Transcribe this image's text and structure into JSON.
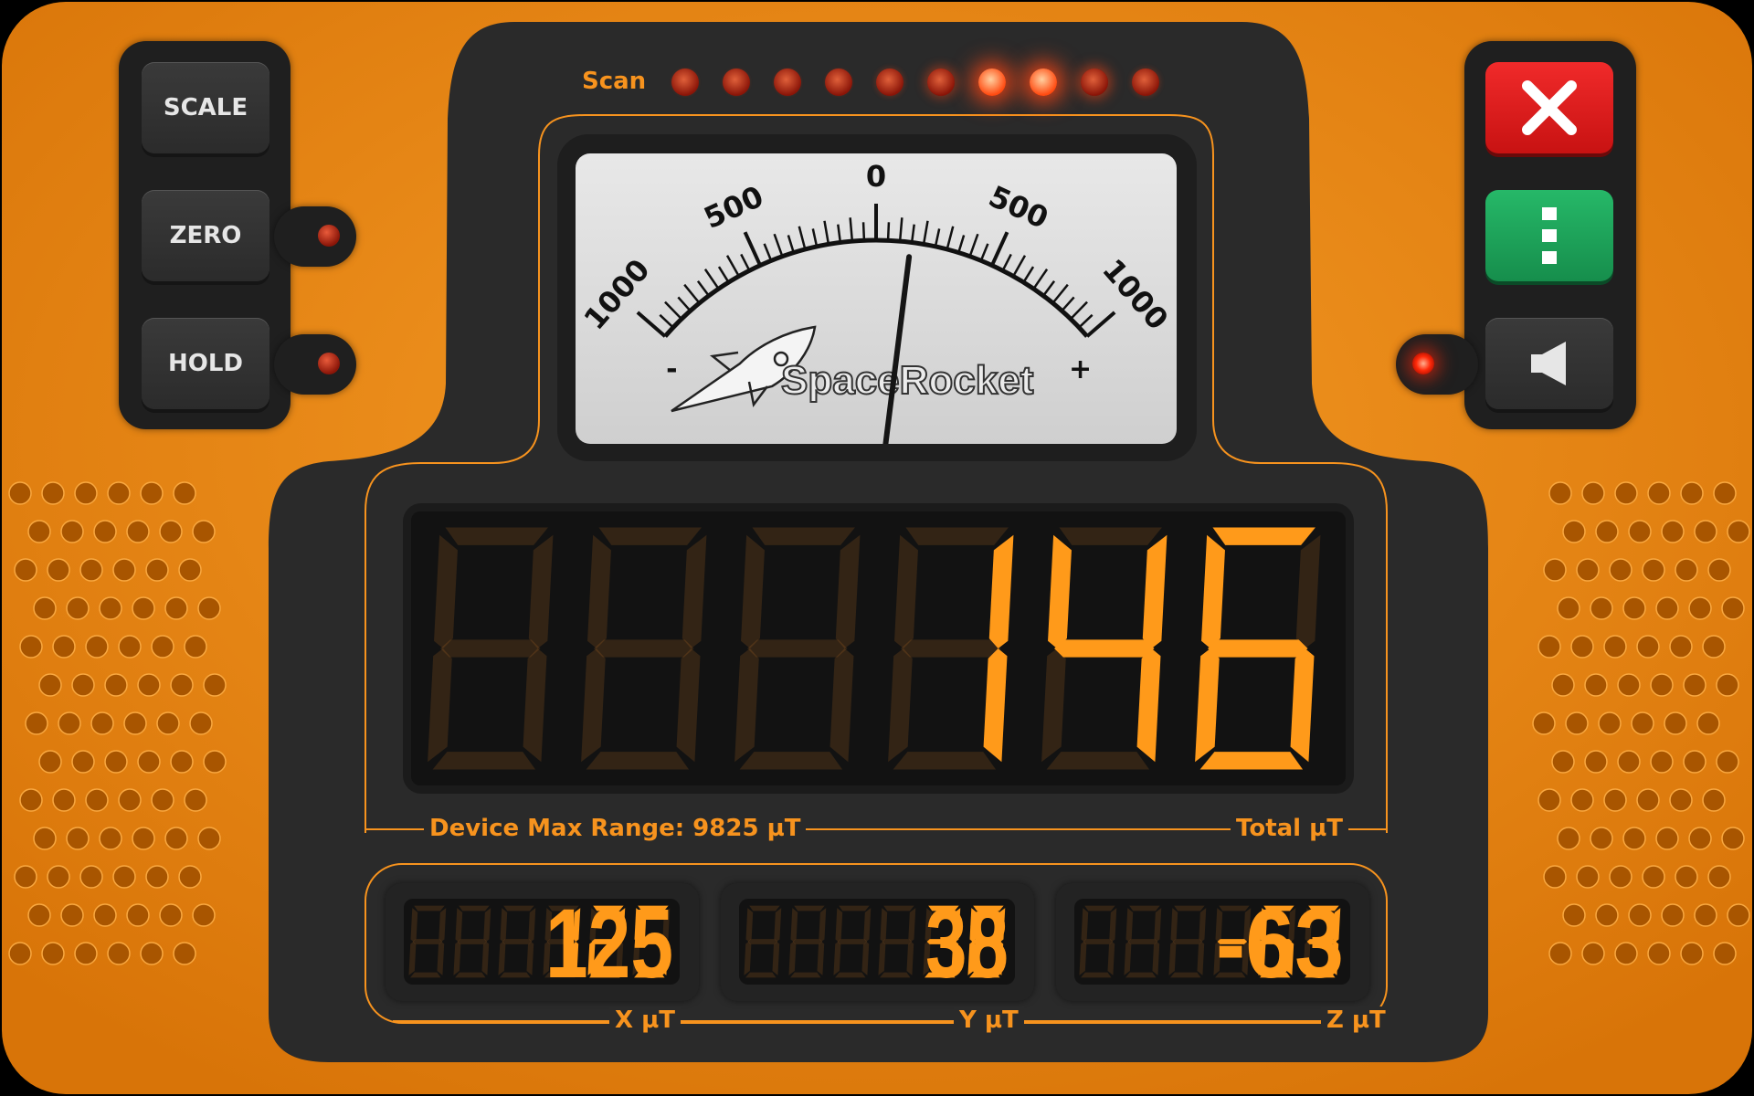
{
  "colors": {
    "body": "#f08a12",
    "panel": "#2a2a2a",
    "accent": "#f7931e",
    "lcd_lit": "#ff9a1a",
    "close": "#e01b1b",
    "menu": "#1fa35a"
  },
  "left_buttons": [
    {
      "label": "SCALE",
      "led": false
    },
    {
      "label": "ZERO",
      "led": true,
      "led_on": false
    },
    {
      "label": "HOLD",
      "led": true,
      "led_on": false
    }
  ],
  "right_buttons": [
    {
      "icon": "close-icon"
    },
    {
      "icon": "menu-dots-icon"
    },
    {
      "icon": "speaker-icon",
      "led_on": true
    }
  ],
  "scan": {
    "label": "Scan",
    "leds": [
      0.1,
      0.1,
      0.1,
      0.1,
      0.2,
      0.4,
      0.9,
      0.9,
      0.5,
      0.2
    ]
  },
  "meter": {
    "brand": "SpaceRocket",
    "min": -1000,
    "max": 1000,
    "value": 146,
    "tick_labels": [
      "1000",
      "500",
      "0",
      "500",
      "1000"
    ],
    "minus": "-",
    "plus": "+"
  },
  "main_display": {
    "value": "146",
    "digits": 6,
    "left_label": "Device Max Range: 9825 µT",
    "right_label": "Total µT"
  },
  "axes": [
    {
      "label": "X µT",
      "value": "125"
    },
    {
      "label": "Y µT",
      "value": "38"
    },
    {
      "label": "Z µT",
      "value": "-63"
    }
  ]
}
